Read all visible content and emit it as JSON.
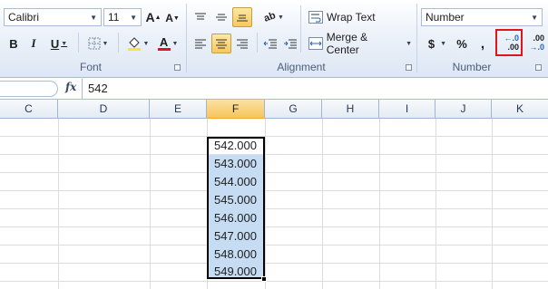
{
  "ribbon": {
    "font_group": {
      "label": "Font",
      "font_name": "Calibri",
      "font_size": "11",
      "grow_label": "A",
      "shrink_label": "A",
      "bold": "B",
      "italic": "I",
      "underline": "U",
      "font_color_label": "A",
      "fill_color": "#f6e34a",
      "font_color": "#e0151b"
    },
    "alignment_group": {
      "label": "Alignment",
      "wrap_text": "Wrap Text",
      "merge_center": "Merge & Center"
    },
    "number_group": {
      "label": "Number",
      "number_format": "Number",
      "currency": "$",
      "percent": "%",
      "comma": ",",
      "increase_decimal_top": "←.0",
      "increase_decimal_bottom": ".00",
      "decrease_decimal_top": ".00",
      "decrease_decimal_bottom": "→.0"
    }
  },
  "formula_bar": {
    "fx_label": "fx",
    "value": "542"
  },
  "sheet": {
    "columns": [
      "C",
      "D",
      "E",
      "F",
      "G",
      "H",
      "I",
      "J",
      "K"
    ],
    "selected_column": "F",
    "column_f_values": [
      "542.000",
      "543.000",
      "544.000",
      "545.000",
      "546.000",
      "547.000",
      "548.000",
      "549.000"
    ],
    "selection_color": "#c5dcf2",
    "highlight_color": "#e0151b"
  }
}
